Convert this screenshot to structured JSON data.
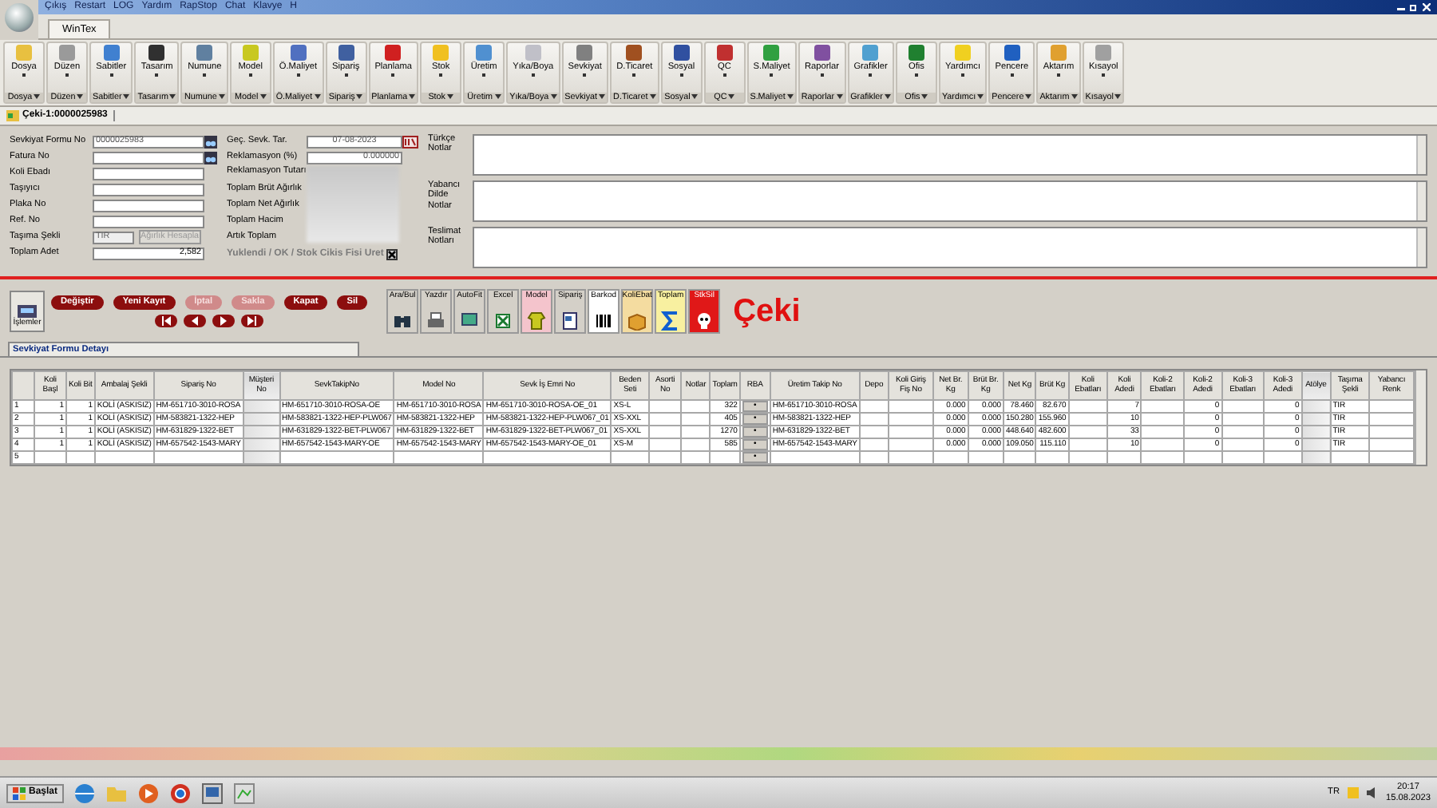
{
  "window": {
    "menu": [
      "Çıkış",
      "Restart",
      "LOG",
      "Yardım",
      "RapStop",
      "Chat",
      "Klavye",
      "H"
    ]
  },
  "ribbon": {
    "tab": {
      "label": "WinTex",
      "selected": true
    },
    "groups": [
      {
        "label": "Dosya",
        "footer": "Dosya"
      },
      {
        "label": "Düzen",
        "footer": "Düzen"
      },
      {
        "label": "Sabitler",
        "footer": "Sabitler"
      },
      {
        "label": "Tasarım",
        "footer": "Tasarım"
      },
      {
        "label": "Numune",
        "footer": "Numune"
      },
      {
        "label": "Model",
        "footer": "Model"
      },
      {
        "label": "Ö.Maliyet",
        "footer": "Ö.Maliyet"
      },
      {
        "label": "Sipariş",
        "footer": "Sipariş"
      },
      {
        "label": "Planlama",
        "footer": "Planlama"
      },
      {
        "label": "Stok",
        "footer": "Stok"
      },
      {
        "label": "Üretim",
        "footer": "Üretim"
      },
      {
        "label": "Yıka/Boya",
        "footer": "Yıka/Boya"
      },
      {
        "label": "Sevkiyat",
        "footer": "Sevkiyat"
      },
      {
        "label": "D.Ticaret",
        "footer": "D.Ticaret"
      },
      {
        "label": "Sosyal",
        "footer": "Sosyal"
      },
      {
        "label": "QC",
        "footer": "QC"
      },
      {
        "label": "S.Maliyet",
        "footer": "S.Maliyet"
      },
      {
        "label": "Raporlar",
        "footer": "Raporlar"
      },
      {
        "label": "Grafikler",
        "footer": "Grafikler"
      },
      {
        "label": "Ofis",
        "footer": "Ofis"
      },
      {
        "label": "Yardımcı",
        "footer": "Yardımcı"
      },
      {
        "label": "Pencere",
        "footer": "Pencere"
      },
      {
        "label": "Aktarım",
        "footer": "Aktarım"
      },
      {
        "label": "Kısayol",
        "footer": "Kısayol"
      }
    ]
  },
  "document_tab": {
    "label": "Çeki-1:0000025983",
    "selected": true
  },
  "form": {
    "left": [
      {
        "label": "Sevkiyat Formu No",
        "kind": "lookup",
        "value": "0000025983"
      },
      {
        "label": "Fatura No",
        "kind": "lookup"
      },
      {
        "label": "Koli Ebadı",
        "kind": "text"
      },
      {
        "label": "Taşıyıcı",
        "kind": "text"
      },
      {
        "label": "Plaka No",
        "kind": "text"
      },
      {
        "label": "Ref. No",
        "kind": "text"
      },
      {
        "label": "Taşıma Şekli",
        "kind": "select",
        "value": "TIR",
        "disabled": true,
        "button": "Ağırlık Hesapla"
      },
      {
        "label": "Toplam Adet",
        "kind": "number",
        "value": "2,582"
      }
    ],
    "middle": [
      {
        "label": "Geç. Sevk. Tar.",
        "kind": "date",
        "value": "07-08-2023"
      },
      {
        "label": "Reklamasyon (%)",
        "kind": "number",
        "value": "0.000000"
      },
      {
        "label": "Reklamasyon Tutarı",
        "kind": "blurred"
      },
      {
        "label": "Toplam Brüt Ağırlık",
        "kind": "blurred"
      },
      {
        "label": "Toplam Net Ağırlık",
        "kind": "blurred"
      },
      {
        "label": "Toplam Hacim",
        "kind": "blurred"
      },
      {
        "label": "Artık Toplam",
        "kind": "blurred"
      }
    ],
    "loaded_checkbox": {
      "label": "Yuklendi / OK / Stok Cikis Fisi Uret",
      "checked": true,
      "disabled": true
    },
    "notes": [
      {
        "label": "Türkçe Notlar"
      },
      {
        "label": "Yabancı Dilde Notlar"
      },
      {
        "label": "Teslimat Notları"
      }
    ]
  },
  "side_button": "İşlemler",
  "actions": [
    {
      "label": "Değiştir",
      "disabled": false
    },
    {
      "label": "Yeni Kayıt",
      "disabled": false
    },
    {
      "label": "İptal",
      "disabled": true
    },
    {
      "label": "Sakla",
      "disabled": true
    },
    {
      "label": "Kapat",
      "disabled": false
    },
    {
      "label": "Sil",
      "disabled": false
    }
  ],
  "navigation": [
    {
      "kind": "first"
    },
    {
      "kind": "previous"
    },
    {
      "kind": "next"
    },
    {
      "kind": "last"
    }
  ],
  "tools": [
    {
      "label": "Ara/Bul",
      "color": "#d4d0c8"
    },
    {
      "label": "Yazdır",
      "color": "#d4d0c8"
    },
    {
      "label": "AutoFit",
      "color": "#d4d0c8"
    },
    {
      "label": "Excel",
      "color": "#d4d0c8"
    },
    {
      "label": "Model",
      "color": "#f4c4cc"
    },
    {
      "label": "Sipariş",
      "color": "#d4d0c8"
    },
    {
      "label": "Barkod",
      "color": "#ffffff"
    },
    {
      "label": "KoliEbat",
      "color": "#f4dca0"
    },
    {
      "label": "Toplam",
      "color": "#f8f0a0"
    },
    {
      "label": "StkSil",
      "color": "#e01818"
    }
  ],
  "module_title": "Çeki",
  "detail_tab": {
    "label": "Sevkiyat Formu Detayı",
    "selected": true
  },
  "table": {
    "columns": [
      {
        "label": "Koli Başl"
      },
      {
        "label": "Koli Bit"
      },
      {
        "label": "Ambalaj Şekli"
      },
      {
        "label": "Sipariş No"
      },
      {
        "label": "Müşteri No",
        "blurred": true
      },
      {
        "label": "SevkTakipNo"
      },
      {
        "label": "Model No"
      },
      {
        "label": "Sevk İş Emri No"
      },
      {
        "label": "Beden Seti"
      },
      {
        "label": "Asorti No"
      },
      {
        "label": "Notlar"
      },
      {
        "label": "Toplam"
      },
      {
        "label": "RBA"
      },
      {
        "label": "Üretim Takip No"
      },
      {
        "label": "Depo"
      },
      {
        "label": "Koli Giriş Fiş No"
      },
      {
        "label": "Net Br. Kg"
      },
      {
        "label": "Brüt Br. Kg"
      },
      {
        "label": "Net Kg"
      },
      {
        "label": "Brüt Kg"
      },
      {
        "label": "Koli Ebatları"
      },
      {
        "label": "Koli Adedi"
      },
      {
        "label": "Koli-2 Ebatları"
      },
      {
        "label": "Koli-2 Adedi"
      },
      {
        "label": "Koli-3 Ebatları"
      },
      {
        "label": "Koli-3 Adedi"
      },
      {
        "label": "Atölye",
        "blurred": true
      },
      {
        "label": "Taşıma Şekli"
      },
      {
        "label": "Yabancı Renk"
      }
    ],
    "rows": [
      {
        "number": "1",
        "cells": [
          "1",
          "1",
          "KOLİ (ASKISIZ)",
          "HM-651710-3010-ROSA",
          null,
          "HM-651710-3010-ROSA-OE",
          "HM-651710-3010-ROSA",
          "HM-651710-3010-ROSA-OE_01",
          "XS-L",
          null,
          null,
          "322",
          "•",
          "HM-651710-3010-ROSA",
          null,
          null,
          "0.000",
          "0.000",
          "78.460",
          "82.670",
          null,
          "7",
          null,
          "0",
          null,
          "0",
          null,
          "TIR",
          null
        ]
      },
      {
        "number": "2",
        "cells": [
          "1",
          "1",
          "KOLİ (ASKISIZ)",
          "HM-583821-1322-HEP",
          null,
          "HM-583821-1322-HEP-PLW067",
          "HM-583821-1322-HEP",
          "HM-583821-1322-HEP-PLW067_01",
          "XS-XXL",
          null,
          null,
          "405",
          "•",
          "HM-583821-1322-HEP",
          null,
          null,
          "0.000",
          "0.000",
          "150.280",
          "155.960",
          null,
          "10",
          null,
          "0",
          null,
          "0",
          null,
          "TIR",
          null
        ]
      },
      {
        "number": "3",
        "cells": [
          "1",
          "1",
          "KOLİ (ASKISIZ)",
          "HM-631829-1322-BET",
          null,
          "HM-631829-1322-BET-PLW067",
          "HM-631829-1322-BET",
          "HM-631829-1322-BET-PLW067_01",
          "XS-XXL",
          null,
          null,
          "1270",
          "•",
          "HM-631829-1322-BET",
          null,
          null,
          "0.000",
          "0.000",
          "448.640",
          "482.600",
          null,
          "33",
          null,
          "0",
          null,
          "0",
          null,
          "TIR",
          null
        ]
      },
      {
        "number": "4",
        "cells": [
          "1",
          "1",
          "KOLİ (ASKISIZ)",
          "HM-657542-1543-MARY",
          null,
          "HM-657542-1543-MARY-OE",
          "HM-657542-1543-MARY",
          "HM-657542-1543-MARY-OE_01",
          "XS-M",
          null,
          null,
          "585",
          "•",
          "HM-657542-1543-MARY",
          null,
          null,
          "0.000",
          "0.000",
          "109.050",
          "115.110",
          null,
          "10",
          null,
          "0",
          null,
          "0",
          null,
          "TIR",
          null
        ]
      },
      {
        "number": "5",
        "cells": [
          null,
          null,
          null,
          null,
          null,
          null,
          null,
          null,
          null,
          null,
          null,
          null,
          "•",
          null,
          null,
          null,
          null,
          null,
          null,
          null,
          null,
          null,
          null,
          null,
          null,
          null,
          null,
          null,
          null
        ]
      }
    ]
  },
  "taskbar": {
    "start": "Başlat",
    "language": "TR",
    "time": "20:17",
    "date": "15.08.2023"
  }
}
